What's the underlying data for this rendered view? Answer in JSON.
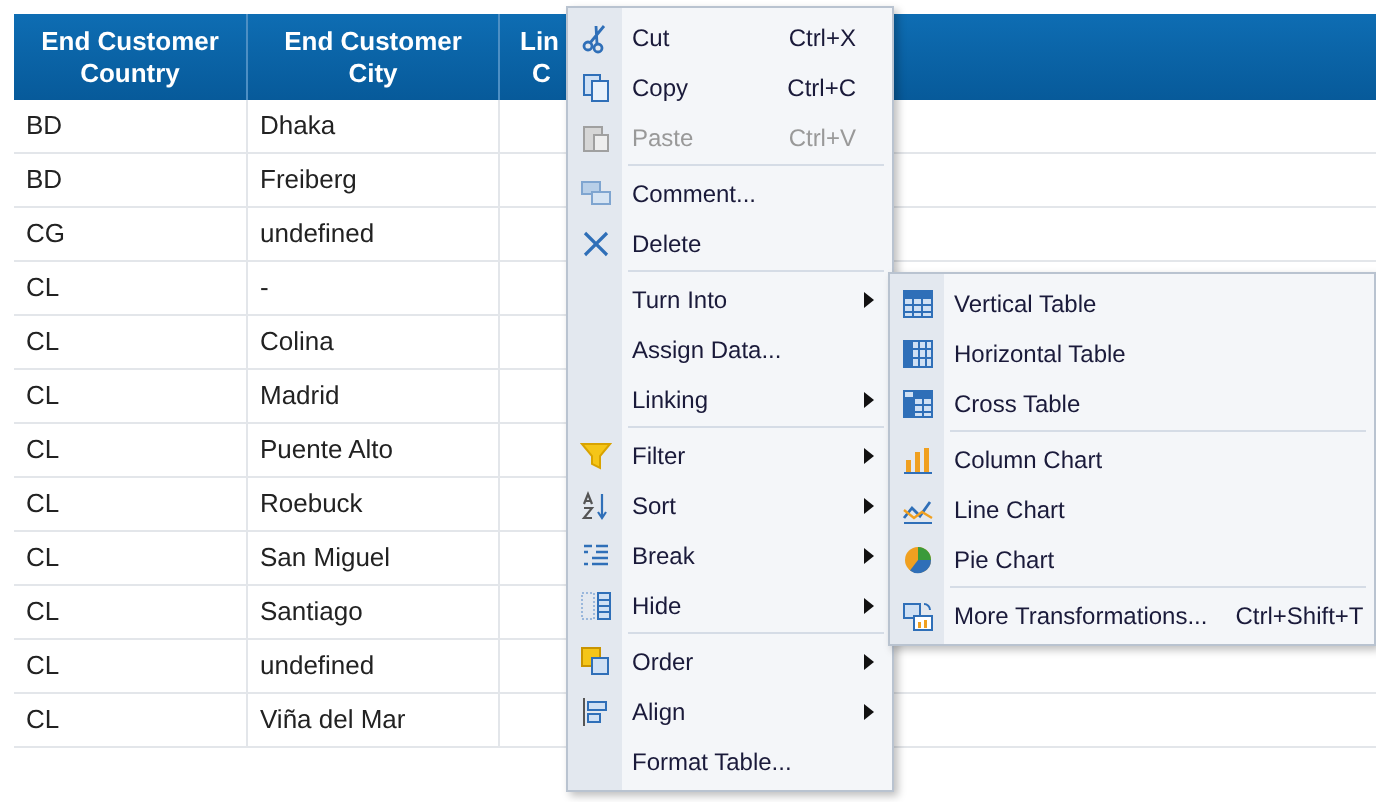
{
  "table": {
    "columns": [
      "End Customer Country",
      "End Customer City",
      "Lin C"
    ],
    "rows": [
      [
        "BD",
        "Dhaka"
      ],
      [
        "BD",
        "Freiberg"
      ],
      [
        "CG",
        "undefined"
      ],
      [
        "CL",
        "-"
      ],
      [
        "CL",
        "Colina"
      ],
      [
        "CL",
        "Madrid"
      ],
      [
        "CL",
        "Puente Alto"
      ],
      [
        "CL",
        "Roebuck"
      ],
      [
        "CL",
        "San Miguel"
      ],
      [
        "CL",
        "Santiago"
      ],
      [
        "CL",
        "undefined"
      ],
      [
        "CL",
        "Viña del Mar"
      ]
    ]
  },
  "context_menu": {
    "groups": [
      [
        {
          "kind": "cut",
          "label": "Cut",
          "shortcut": "Ctrl+X",
          "disabled": false,
          "submenu": false
        },
        {
          "kind": "copy",
          "label": "Copy",
          "shortcut": "Ctrl+C",
          "disabled": false,
          "submenu": false
        },
        {
          "kind": "paste",
          "label": "Paste",
          "shortcut": "Ctrl+V",
          "disabled": true,
          "submenu": false
        }
      ],
      [
        {
          "kind": "comment",
          "label": "Comment...",
          "disabled": false,
          "submenu": false
        },
        {
          "kind": "delete",
          "label": "Delete",
          "disabled": false,
          "submenu": false
        }
      ],
      [
        {
          "label": "Turn Into",
          "disabled": false,
          "submenu": true
        },
        {
          "label": "Assign Data...",
          "disabled": false,
          "submenu": false
        },
        {
          "label": "Linking",
          "disabled": false,
          "submenu": true
        }
      ],
      [
        {
          "kind": "filter",
          "label": "Filter",
          "disabled": false,
          "submenu": true
        },
        {
          "kind": "sort",
          "label": "Sort",
          "disabled": false,
          "submenu": true
        },
        {
          "kind": "break",
          "label": "Break",
          "disabled": false,
          "submenu": true
        },
        {
          "kind": "hide",
          "label": "Hide",
          "disabled": false,
          "submenu": true
        }
      ],
      [
        {
          "kind": "order",
          "label": "Order",
          "disabled": false,
          "submenu": true
        },
        {
          "kind": "align",
          "label": "Align",
          "disabled": false,
          "submenu": true
        },
        {
          "label": "Format Table...",
          "disabled": false,
          "submenu": false
        }
      ]
    ]
  },
  "submenu": {
    "groups": [
      [
        {
          "kind": "vtable",
          "label": "Vertical Table"
        },
        {
          "kind": "htable",
          "label": "Horizontal Table"
        },
        {
          "kind": "xtable",
          "label": "Cross Table"
        }
      ],
      [
        {
          "kind": "column",
          "label": "Column Chart"
        },
        {
          "kind": "line",
          "label": "Line Chart"
        },
        {
          "kind": "pie",
          "label": "Pie Chart"
        }
      ],
      [
        {
          "kind": "more",
          "label": "More Transformations...",
          "shortcut": "Ctrl+Shift+T"
        }
      ]
    ]
  }
}
